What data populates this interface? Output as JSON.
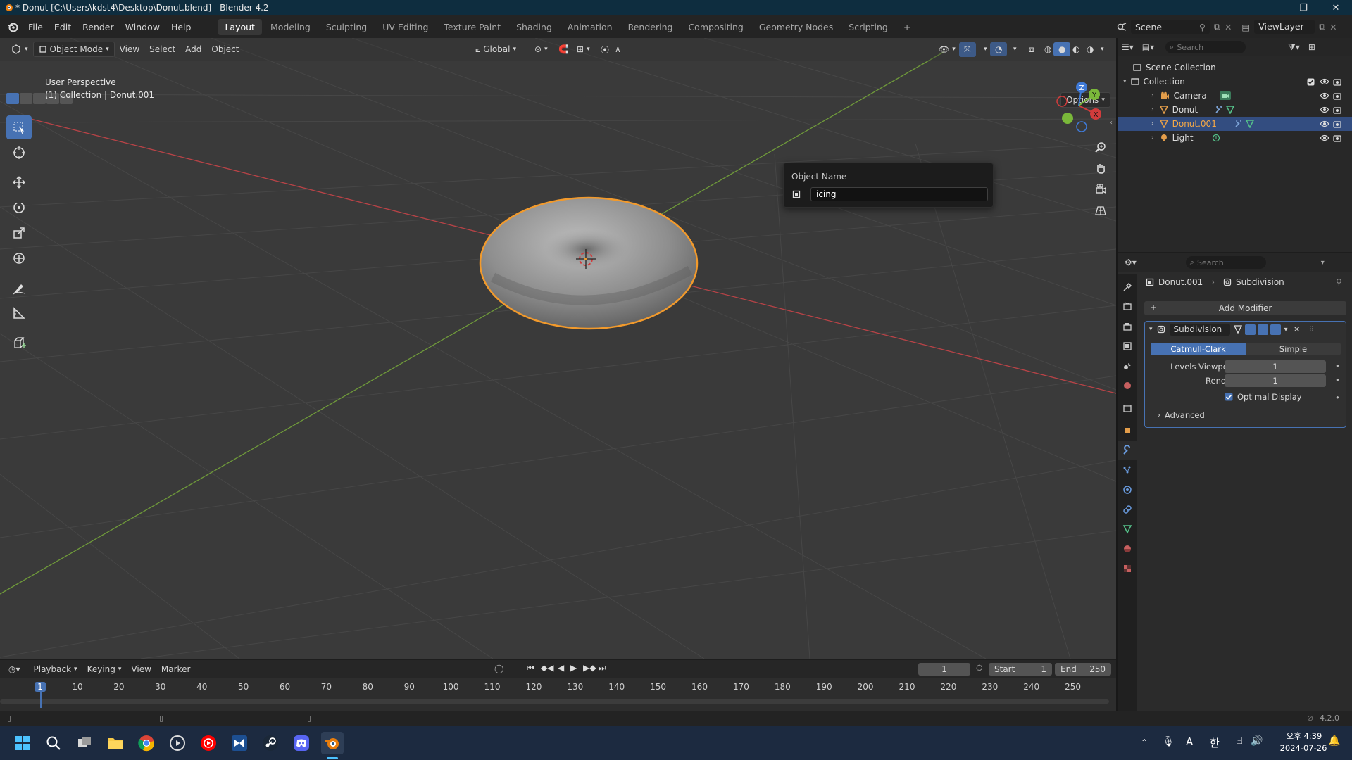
{
  "window": {
    "title": "* Donut [C:\\Users\\kdst4\\Desktop\\Donut.blend] - Blender 4.2"
  },
  "menu": [
    "File",
    "Edit",
    "Render",
    "Window",
    "Help"
  ],
  "workspaces": [
    "Layout",
    "Modeling",
    "Sculpting",
    "UV Editing",
    "Texture Paint",
    "Shading",
    "Animation",
    "Rendering",
    "Compositing",
    "Geometry Nodes",
    "Scripting"
  ],
  "scene_field": "Scene",
  "viewlayer_field": "ViewLayer",
  "viewport": {
    "mode": "Object Mode",
    "menus": [
      "View",
      "Select",
      "Add",
      "Object"
    ],
    "transform_orientation": "Global",
    "options_label": "Options",
    "info_line1": "User Perspective",
    "info_line2": "(1) Collection | Donut.001",
    "gizmo_axes": [
      "X",
      "Y",
      "Z"
    ]
  },
  "popup": {
    "title": "Object Name",
    "value": "icing"
  },
  "outliner": {
    "search_placeholder": "Search",
    "scene_collection": "Scene Collection",
    "collection": "Collection",
    "items": [
      "Camera",
      "Donut",
      "Donut.001",
      "Light"
    ],
    "selected": "Donut.001"
  },
  "properties": {
    "search_placeholder": "Search",
    "breadcrumb_object": "Donut.001",
    "breadcrumb_modifier": "Subdivision",
    "add_modifier": "Add Modifier",
    "modifier_name": "Subdivision",
    "catmull_clark": "Catmull-Clark",
    "simple": "Simple",
    "levels_viewport_label": "Levels Viewport",
    "levels_viewport_value": "1",
    "render_label": "Render",
    "render_value": "1",
    "optimal_display": "Optimal Display",
    "optimal_display_checked": true,
    "advanced": "Advanced"
  },
  "timeline": {
    "menus": [
      "Playback",
      "Keying",
      "View",
      "Marker"
    ],
    "current_frame": "1",
    "start_label": "Start",
    "start_value": "1",
    "end_label": "End",
    "end_value": "250",
    "ruler_ticks": [
      "1",
      "10",
      "20",
      "30",
      "40",
      "50",
      "60",
      "70",
      "80",
      "90",
      "100",
      "110",
      "120",
      "130",
      "140",
      "150",
      "160",
      "170",
      "180",
      "190",
      "200",
      "210",
      "220",
      "230",
      "240",
      "250"
    ]
  },
  "status": {
    "version": "4.2.0"
  },
  "taskbar": {
    "lang": "A",
    "ime": "한",
    "time": "오후 4:39",
    "date": "2024-07-26"
  },
  "colors": {
    "accent": "#4772b3",
    "selection_outline": "#f29a2c",
    "axis_x": "#b84347",
    "axis_y": "#6f9a3a"
  }
}
